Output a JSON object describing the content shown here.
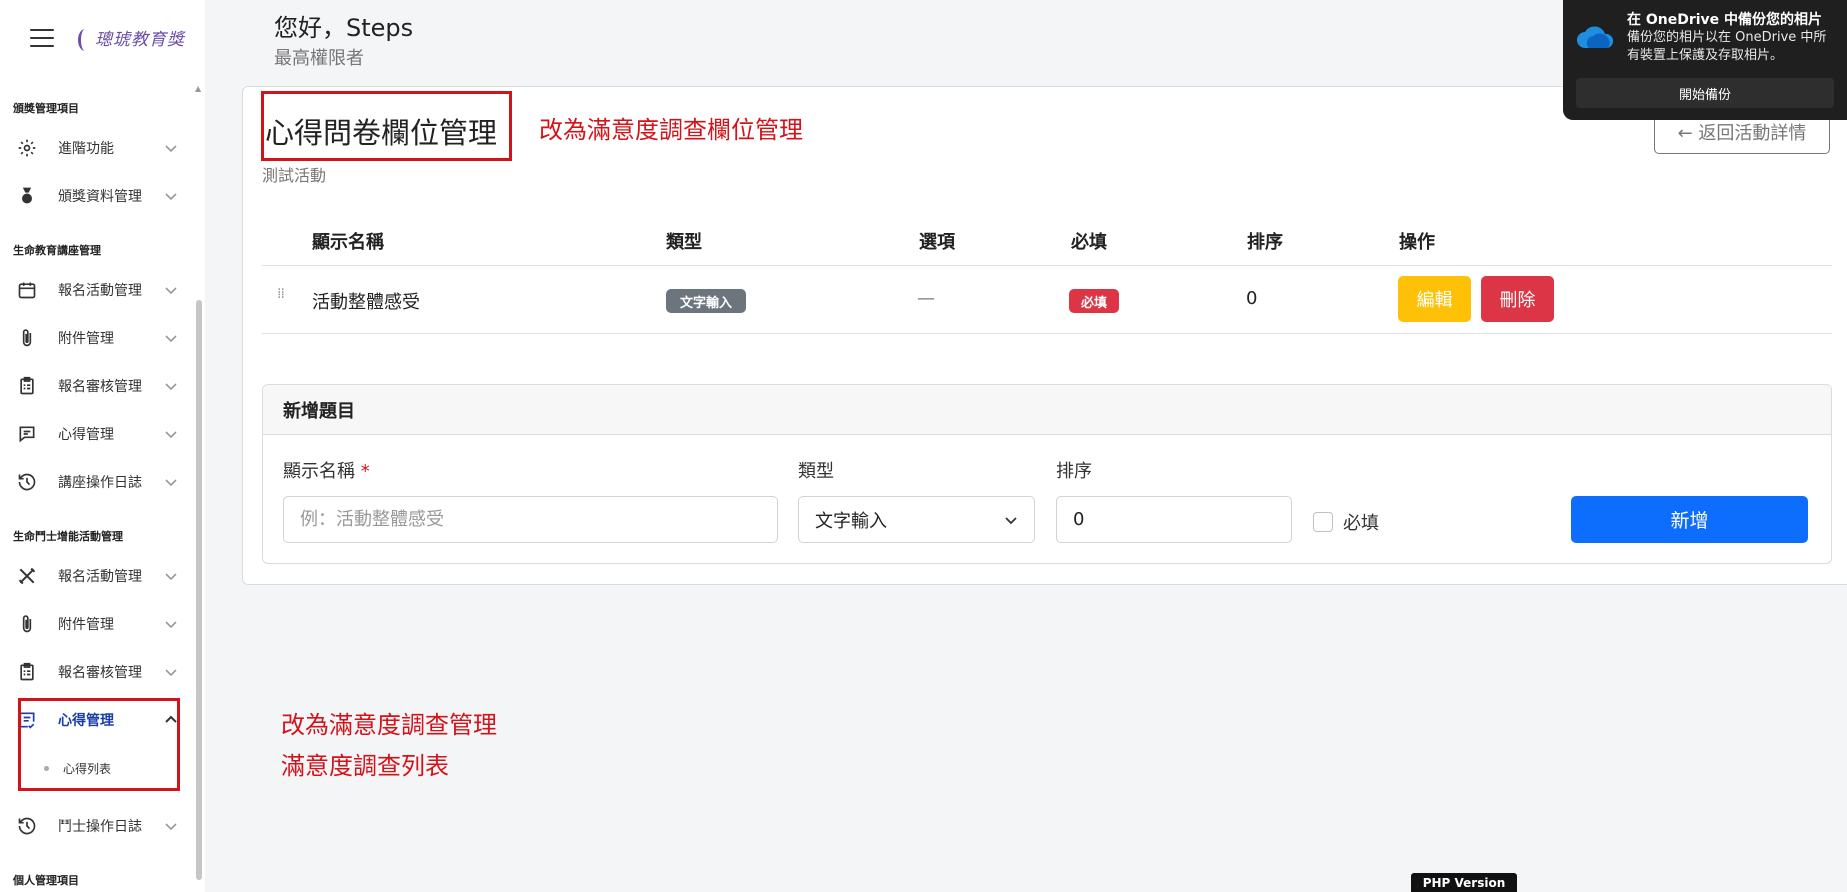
{
  "sidebar": {
    "logo_text": "璁琥教育獎",
    "sections": [
      {
        "title": "頒獎管理項目"
      },
      {
        "title": "生命教育講座管理"
      },
      {
        "title": "生命鬥士增能活動管理"
      },
      {
        "title": "個人管理項目"
      }
    ],
    "items": [
      {
        "label": "進階功能"
      },
      {
        "label": "頒獎資料管理"
      },
      {
        "label": "報名活動管理"
      },
      {
        "label": "附件管理"
      },
      {
        "label": "報名審核管理"
      },
      {
        "label": "心得管理"
      },
      {
        "label": "講座操作日誌"
      },
      {
        "label": "報名活動管理"
      },
      {
        "label": "附件管理"
      },
      {
        "label": "報名審核管理"
      },
      {
        "label": "心得管理"
      },
      {
        "label": "鬥士操作日誌"
      }
    ],
    "sub_items": [
      {
        "label": "心得列表"
      }
    ]
  },
  "header": {
    "greeting": "您好，Steps",
    "role": "最高權限者"
  },
  "page": {
    "title": "心得問卷欄位管理",
    "subtitle": "測試活動",
    "back_label": "← 返回活動詳情"
  },
  "annotations": {
    "title_note": "改為滿意度調查欄位管理",
    "sidebar_note_1": "改為滿意度調查管理",
    "sidebar_note_2": "滿意度調查列表"
  },
  "table": {
    "columns": [
      "顯示名稱",
      "類型",
      "選項",
      "必填",
      "排序",
      "操作"
    ],
    "rows": [
      {
        "name": "活動整體感受",
        "type": "文字輸入",
        "options": "—",
        "required": "必填",
        "order": "0",
        "edit": "編輯",
        "delete": "刪除"
      }
    ]
  },
  "add_form": {
    "heading": "新增題目",
    "name_label": "顯示名稱",
    "name_required_mark": "*",
    "name_placeholder": "例：活動整體感受",
    "type_label": "類型",
    "type_value": "文字輸入",
    "order_label": "排序",
    "order_value": "0",
    "required_label": "必填",
    "submit_label": "新增"
  },
  "toast": {
    "title": "在 OneDrive 中備份您的相片",
    "body": "備份您的相片以在 OneDrive 中所有裝置上保護及存取相片。",
    "button": "開始備份"
  },
  "footer": {
    "php_label": "PHP Version"
  },
  "colors": {
    "primary": "#0d6efd",
    "warning": "#ffc107",
    "danger": "#dc3545",
    "annotation_red": "#d3131a",
    "sidebar_active": "#1a3ea8"
  }
}
